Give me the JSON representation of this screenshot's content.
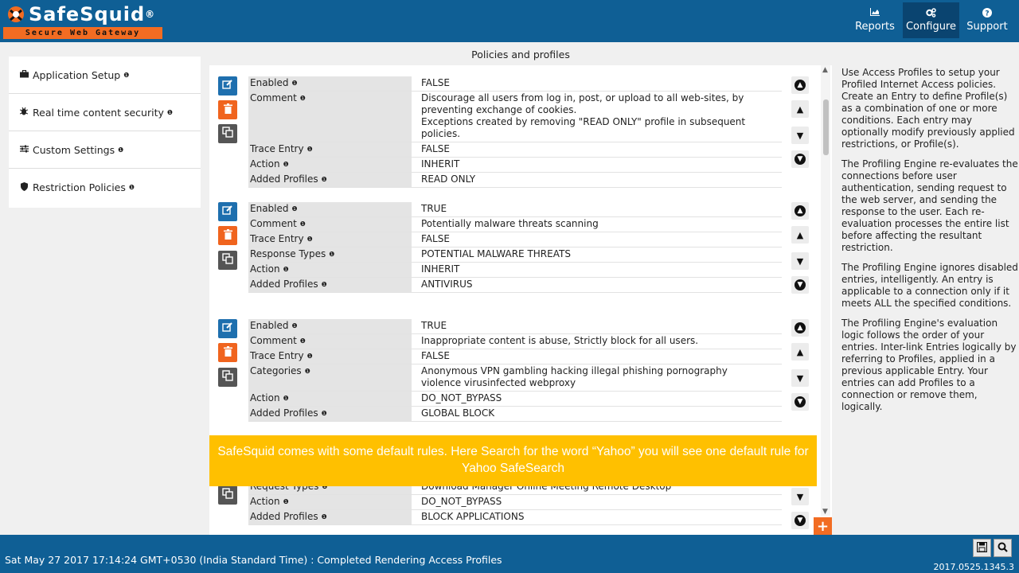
{
  "brand": {
    "name": "SafeSquid",
    "registered": "®",
    "tagline": "Secure Web Gateway"
  },
  "header_nav": [
    {
      "label": "Reports",
      "icon": "bar-chart-icon"
    },
    {
      "label": "Configure",
      "icon": "cogs-icon",
      "active": true
    },
    {
      "label": "Support",
      "icon": "question-circle-icon"
    }
  ],
  "sidebar": {
    "items": [
      {
        "label": "Application Setup",
        "icon": "briefcase-icon"
      },
      {
        "label": "Real time content security",
        "icon": "bug-icon"
      },
      {
        "label": "Custom Settings",
        "icon": "sliders-icon"
      },
      {
        "label": "Restriction Policies",
        "icon": "shield-icon"
      }
    ]
  },
  "info_mark": "❶",
  "main": {
    "title": "Policies and profiles",
    "entries": [
      {
        "rows": [
          {
            "label": "Enabled",
            "value": "FALSE"
          },
          {
            "label": "Comment",
            "value": "Discourage all users from log in, post, or upload to all web-sites, by preventing exchange of cookies.\nExceptions created by removing \"READ ONLY\" profile in subsequent policies."
          },
          {
            "label": "Trace Entry",
            "value": "FALSE"
          },
          {
            "label": "Action",
            "value": "INHERIT"
          },
          {
            "label": "Added Profiles",
            "value": "READ ONLY"
          }
        ]
      },
      {
        "rows": [
          {
            "label": "Enabled",
            "value": "TRUE"
          },
          {
            "label": "Comment",
            "value": "Potentially malware threats scanning"
          },
          {
            "label": "Trace Entry",
            "value": "FALSE"
          },
          {
            "label": "Response Types",
            "value": "POTENTIAL MALWARE THREATS"
          },
          {
            "label": "Action",
            "value": "INHERIT"
          },
          {
            "label": "Added Profiles",
            "value": "ANTIVIRUS"
          }
        ]
      },
      {
        "rows": [
          {
            "label": "Enabled",
            "value": "TRUE"
          },
          {
            "label": "Comment",
            "value": "Inappropriate content is abuse, Strictly block for all users."
          },
          {
            "label": "Trace Entry",
            "value": "FALSE"
          },
          {
            "label": "Categories",
            "value": "Anonymous VPN  gambling  hacking  illegal  phishing  pornography\nviolence  virusinfected  webproxy"
          },
          {
            "label": "Action",
            "value": "DO_NOT_BYPASS"
          },
          {
            "label": "Added Profiles",
            "value": "GLOBAL BLOCK"
          }
        ]
      },
      {
        "rows": [
          {
            "label": "Request Types",
            "value": "Download Manager  Online Meeting  Remote Desktop"
          },
          {
            "label": "Action",
            "value": "DO_NOT_BYPASS"
          },
          {
            "label": "Added Profiles",
            "value": "BLOCK APPLICATIONS"
          }
        ]
      }
    ]
  },
  "right_panel": {
    "paragraphs": [
      "Use Access Profiles to setup your Profiled Internet Access policies. Create an Entry to define Profile(s) as a combination of one or more conditions. Each entry may optionally modify previously applied restrictions, or Profile(s).",
      "The Profiling Engine re-evaluates the connections before user authentication, sending request to the web server, and sending the response to the user. Each re-evaluation processes the entire list before affecting the resultant restriction.",
      "The Profiling Engine ignores disabled entries, intelligently. An entry is applicable to a connection only if it meets ALL the specified conditions.",
      "The Profiling Engine's evaluation logic follows the order of your entries. Inter-link Entries logically by referring to Profiles, applied in a previous applicable Entry. Your entries can add Profiles to a connection or remove them, logically."
    ]
  },
  "overlay": {
    "text": "SafeSquid comes with some default rules. Here Search for the word “Yahoo” you will see one default rule for Yahoo SafeSearch"
  },
  "footer": {
    "status": "Sat May 27 2017 17:14:24 GMT+0530 (India Standard Time) : Completed Rendering Access Profiles",
    "version": "2017.0525.1345.3"
  }
}
